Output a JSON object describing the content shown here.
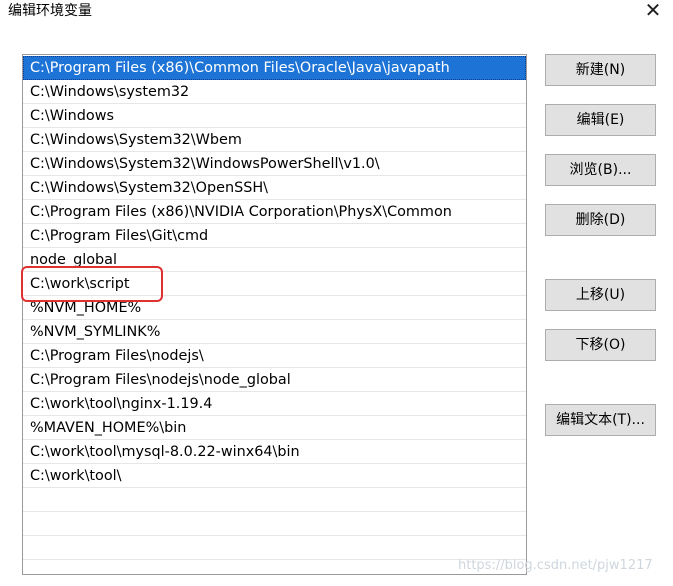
{
  "window": {
    "title": "编辑环境变量",
    "close_label": "✕"
  },
  "list": {
    "items": [
      "C:\\Program Files (x86)\\Common Files\\Oracle\\Java\\javapath",
      "C:\\Windows\\system32",
      "C:\\Windows",
      "C:\\Windows\\System32\\Wbem",
      "C:\\Windows\\System32\\WindowsPowerShell\\v1.0\\",
      "C:\\Windows\\System32\\OpenSSH\\",
      "C:\\Program Files (x86)\\NVIDIA Corporation\\PhysX\\Common",
      "C:\\Program Files\\Git\\cmd",
      "node_global",
      "C:\\work\\script",
      "%NVM_HOME%",
      "%NVM_SYMLINK%",
      "C:\\Program Files\\nodejs\\",
      "C:\\Program Files\\nodejs\\node_global",
      "C:\\work\\tool\\nginx-1.19.4",
      "%MAVEN_HOME%\\bin",
      "C:\\work\\tool\\mysql-8.0.22-winx64\\bin",
      "C:\\work\\tool\\",
      "",
      "",
      ""
    ],
    "selected_index": 0,
    "highlight_color": "#e03131",
    "selection_color": "#1e74d6"
  },
  "buttons": {
    "new": "新建(N)",
    "edit": "编辑(E)",
    "browse": "浏览(B)...",
    "delete": "删除(D)",
    "move_up": "上移(U)",
    "move_down": "下移(O)",
    "edit_text": "编辑文本(T)..."
  },
  "watermark": "https://blog.csdn.net/pjw1217"
}
